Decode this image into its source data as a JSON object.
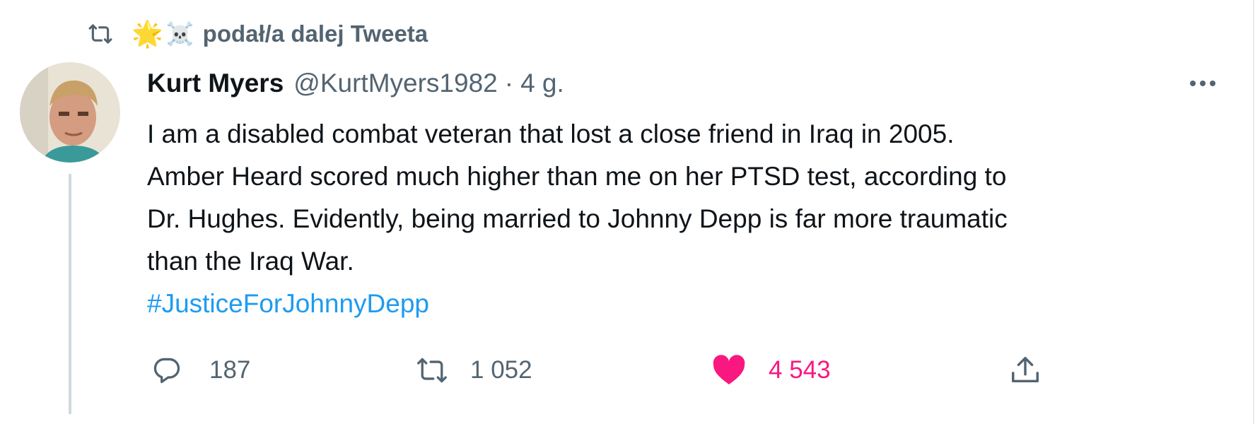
{
  "retweet_context": {
    "emoji_1": "🌟",
    "emoji_2": "☠️",
    "text": "podał/a dalej Tweeta"
  },
  "tweet": {
    "author_name": "Kurt Myers",
    "handle": "@KurtMyers1982",
    "separator": "·",
    "time": "4 g.",
    "text_lines": [
      "I am a disabled combat veteran that lost a close friend in Iraq in 2005.",
      "Amber Heard scored much higher than me on her PTSD test, according to",
      "Dr. Hughes. Evidently, being married to Johnny Depp is far more traumatic",
      "than the Iraq War."
    ],
    "hashtag": "#JusticeForJohnnyDepp"
  },
  "actions": {
    "replies": "187",
    "retweets": "1 052",
    "likes": "4 543"
  },
  "colors": {
    "text": "#0f1419",
    "muted": "#536471",
    "link": "#1d9bf0",
    "like": "#f91880"
  },
  "icons": [
    "retweet-icon",
    "more-icon",
    "reply-icon",
    "heart-icon",
    "share-icon"
  ]
}
